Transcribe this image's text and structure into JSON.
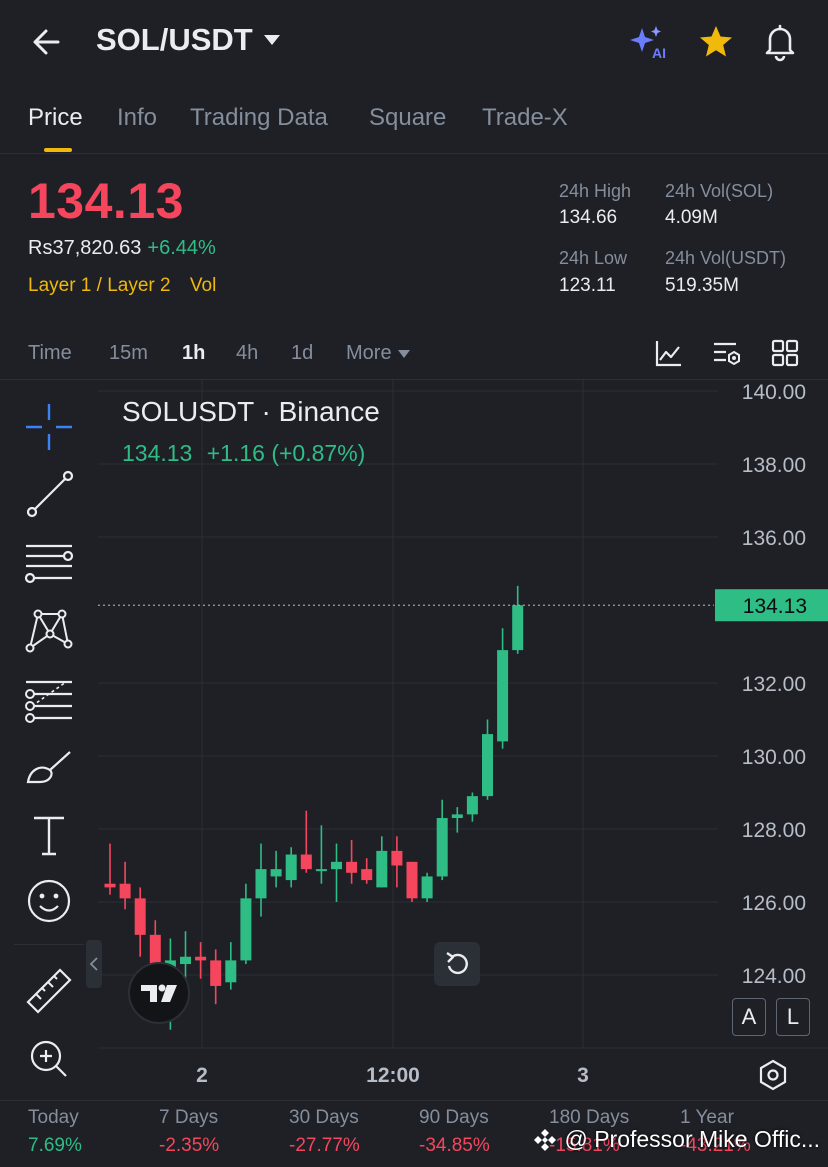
{
  "header": {
    "pair": "SOL/USDT",
    "ai_label": "AI"
  },
  "tabs": [
    {
      "label": "Price",
      "active": true
    },
    {
      "label": "Info",
      "active": false
    },
    {
      "label": "Trading Data",
      "active": false
    },
    {
      "label": "Square",
      "active": false
    },
    {
      "label": "Trade-X",
      "active": false
    }
  ],
  "price": {
    "last": "134.13",
    "fiat": "Rs37,820.63",
    "change_pct": "+6.44%",
    "tags": "Layer 1 / Layer 2",
    "vol_tag": "Vol"
  },
  "stats": {
    "high_label": "24h High",
    "high_value": "134.66",
    "low_label": "24h Low",
    "low_value": "123.11",
    "vol_sol_label": "24h Vol(SOL)",
    "vol_sol_value": "4.09M",
    "vol_usdt_label": "24h Vol(USDT)",
    "vol_usdt_value": "519.35M"
  },
  "timeframes": [
    "Time",
    "15m",
    "1h",
    "4h",
    "1d",
    "More"
  ],
  "active_timeframe": "1h",
  "chart_header": {
    "title": "SOLUSDT · Binance",
    "last": "134.13",
    "change": "+1.16 (+0.87%)"
  },
  "chart_data": {
    "type": "candlestick",
    "y_ticks": [
      "140.00",
      "138.00",
      "136.00",
      "134.13",
      "132.00",
      "130.00",
      "128.00",
      "126.00",
      "124.00"
    ],
    "x_ticks": [
      "2",
      "12:00",
      "3"
    ],
    "ylim": [
      122,
      140.3
    ],
    "last_price": 134.13,
    "colors": {
      "up": "#2ebd85",
      "down": "#f6465d"
    },
    "candles": [
      {
        "o": 126.5,
        "h": 127.6,
        "l": 126.2,
        "c": 126.4
      },
      {
        "o": 126.5,
        "h": 127.1,
        "l": 125.8,
        "c": 126.1
      },
      {
        "o": 126.1,
        "h": 126.4,
        "l": 124.5,
        "c": 125.1
      },
      {
        "o": 125.1,
        "h": 125.5,
        "l": 123.0,
        "c": 123.3
      },
      {
        "o": 123.3,
        "h": 125.0,
        "l": 122.5,
        "c": 124.4
      },
      {
        "o": 124.3,
        "h": 125.2,
        "l": 123.5,
        "c": 124.5
      },
      {
        "o": 124.5,
        "h": 124.9,
        "l": 123.9,
        "c": 124.4
      },
      {
        "o": 124.4,
        "h": 124.7,
        "l": 123.2,
        "c": 123.7
      },
      {
        "o": 123.8,
        "h": 124.9,
        "l": 123.6,
        "c": 124.4
      },
      {
        "o": 124.4,
        "h": 126.5,
        "l": 124.3,
        "c": 126.1
      },
      {
        "o": 126.1,
        "h": 127.6,
        "l": 125.6,
        "c": 126.9
      },
      {
        "o": 126.7,
        "h": 127.4,
        "l": 126.4,
        "c": 126.9
      },
      {
        "o": 126.6,
        "h": 127.5,
        "l": 126.4,
        "c": 127.3
      },
      {
        "o": 127.3,
        "h": 128.5,
        "l": 126.8,
        "c": 126.9
      },
      {
        "o": 126.9,
        "h": 128.1,
        "l": 126.5,
        "c": 126.9
      },
      {
        "o": 126.9,
        "h": 127.6,
        "l": 126.0,
        "c": 127.1
      },
      {
        "o": 127.1,
        "h": 127.7,
        "l": 126.5,
        "c": 126.8
      },
      {
        "o": 126.9,
        "h": 127.2,
        "l": 126.5,
        "c": 126.6
      },
      {
        "o": 126.4,
        "h": 127.8,
        "l": 126.4,
        "c": 127.4
      },
      {
        "o": 127.4,
        "h": 127.8,
        "l": 126.4,
        "c": 127.0
      },
      {
        "o": 127.1,
        "h": 127.1,
        "l": 126.0,
        "c": 126.1
      },
      {
        "o": 126.1,
        "h": 126.8,
        "l": 126.0,
        "c": 126.7
      },
      {
        "o": 126.7,
        "h": 128.8,
        "l": 126.6,
        "c": 128.3
      },
      {
        "o": 128.3,
        "h": 128.6,
        "l": 127.9,
        "c": 128.4
      },
      {
        "o": 128.4,
        "h": 129.0,
        "l": 128.2,
        "c": 128.9
      },
      {
        "o": 128.9,
        "h": 131.0,
        "l": 128.8,
        "c": 130.6
      },
      {
        "o": 130.4,
        "h": 133.5,
        "l": 130.2,
        "c": 132.9
      },
      {
        "o": 132.9,
        "h": 134.66,
        "l": 132.8,
        "c": 134.13
      }
    ]
  },
  "scale_buttons": [
    "A",
    "L"
  ],
  "performance": [
    {
      "label": "Today",
      "value": "7.69%",
      "dir": "up"
    },
    {
      "label": "7 Days",
      "value": "-2.35%",
      "dir": "down"
    },
    {
      "label": "30 Days",
      "value": "-27.77%",
      "dir": "down"
    },
    {
      "label": "90 Days",
      "value": "-34.85%",
      "dir": "down"
    },
    {
      "label": "180 Days",
      "value": "-15.81%",
      "dir": "down"
    },
    {
      "label": "1 Year",
      "value": "-43.21%",
      "dir": "down"
    }
  ],
  "watermark": "@ Professor Mike Offic..."
}
